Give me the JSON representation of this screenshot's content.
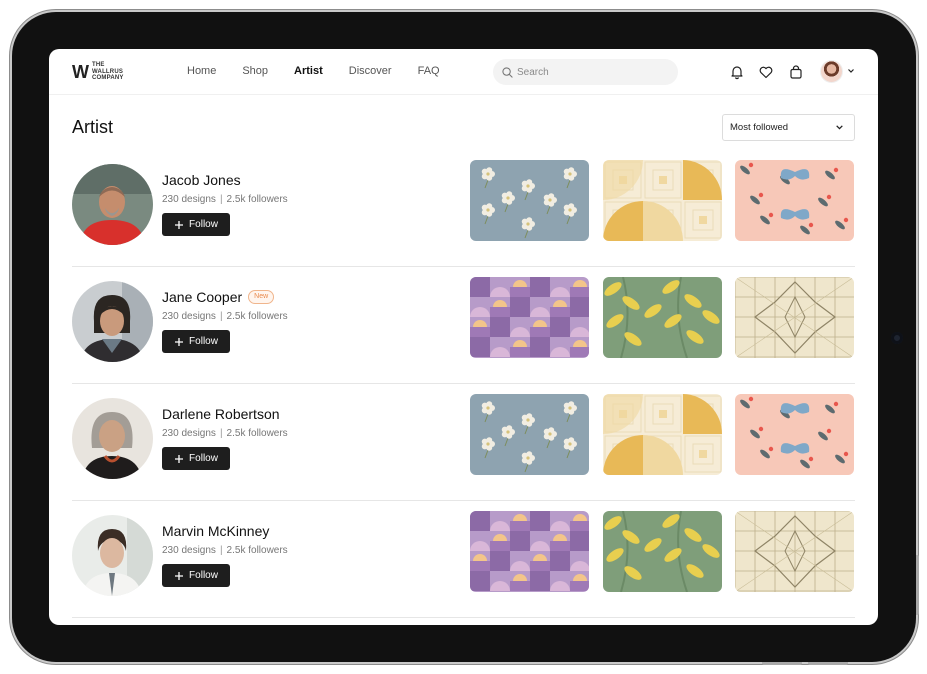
{
  "header": {
    "logo": {
      "mark": "W",
      "line1": "THE",
      "line2": "WALLRUS",
      "line3": "COMPANY"
    },
    "nav": [
      {
        "label": "Home",
        "active": false
      },
      {
        "label": "Shop",
        "active": false
      },
      {
        "label": "Artist",
        "active": true
      },
      {
        "label": "Discover",
        "active": false
      },
      {
        "label": "FAQ",
        "active": false
      }
    ],
    "search": {
      "placeholder": "Search",
      "icon": "search-icon"
    },
    "icons": [
      "bell-icon",
      "heart-icon",
      "bag-icon",
      "avatar",
      "chevron-down-icon"
    ]
  },
  "page": {
    "title": "Artist",
    "sort": {
      "selected": "Most followed",
      "icon": "chevron-down-icon"
    }
  },
  "artists": [
    {
      "name": "Jacob Jones",
      "badge": "",
      "designs": "230 designs",
      "followers": "2.5k followers",
      "follow_label": "Follow",
      "thumbs": [
        "floral-blue",
        "geometric-yellow",
        "butterfly-pink"
      ]
    },
    {
      "name": "Jane Cooper",
      "badge": "New",
      "designs": "230 designs",
      "followers": "2.5k followers",
      "follow_label": "Follow",
      "thumbs": [
        "geometric-purple",
        "leaf-green",
        "lattice-beige"
      ]
    },
    {
      "name": "Darlene Robertson",
      "badge": "",
      "designs": "230 designs",
      "followers": "2.5k followers",
      "follow_label": "Follow",
      "thumbs": [
        "floral-blue",
        "geometric-yellow",
        "butterfly-pink"
      ]
    },
    {
      "name": "Marvin McKinney",
      "badge": "",
      "designs": "230 designs",
      "followers": "2.5k followers",
      "follow_label": "Follow",
      "thumbs": [
        "geometric-purple",
        "leaf-green",
        "lattice-beige"
      ]
    }
  ],
  "colors": {
    "follow_bg": "#1e1e1e",
    "badge_text": "#e98a4d",
    "nav_active": "#111111"
  }
}
